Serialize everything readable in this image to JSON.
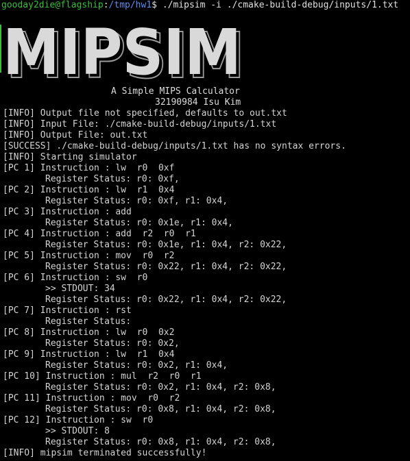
{
  "terminal": {
    "prompt": {
      "user_host": "gooday2die@flagship",
      "separator": ":",
      "path": "/tmp/hw1",
      "symbol": "$",
      "command": "./mipsim -i ./cmake-build-debug/inputs/1.txt"
    },
    "banner": {
      "text": "MIPSIM",
      "fill_color": "#d9d9d9",
      "shadow_color": "#9a9a9a"
    },
    "subtitle": "A Simple MIPS Calculator",
    "author": "32190984 Isu Kim",
    "log_lines": [
      "[INFO] Output file not specified, defaults to out.txt",
      "[INFO] Input File: ./cmake-build-debug/inputs/1.txt",
      "[INFO] Output File: out.txt",
      "[SUCCESS] ./cmake-build-debug/inputs/1.txt has no syntax errors.",
      "[INFO] Starting simulator",
      "[PC 1] Instruction : lw  r0  0xf",
      "Register Status: r0: 0xf,",
      "[PC 2] Instruction : lw  r1  0x4",
      "Register Status: r0: 0xf, r1: 0x4,",
      "[PC 3] Instruction : add",
      "Register Status: r0: 0x1e, r1: 0x4,",
      "[PC 4] Instruction : add  r2  r0  r1",
      "Register Status: r0: 0x1e, r1: 0x4, r2: 0x22,",
      "[PC 5] Instruction : mov  r0  r2",
      "Register Status: r0: 0x22, r1: 0x4, r2: 0x22,",
      "[PC 6] Instruction : sw  r0",
      ">> STDOUT: 34",
      "Register Status: r0: 0x22, r1: 0x4, r2: 0x22,",
      "[PC 7] Instruction : rst",
      "Register Status:",
      "[PC 8] Instruction : lw  r0  0x2",
      "Register Status: r0: 0x2,",
      "[PC 9] Instruction : lw  r1  0x4",
      "Register Status: r0: 0x2, r1: 0x4,",
      "[PC 10] Instruction : mul  r2  r0  r1",
      "Register Status: r0: 0x2, r1: 0x4, r2: 0x8,",
      "[PC 11] Instruction : mov  r0  r2",
      "Register Status: r0: 0x8, r1: 0x4, r2: 0x8,",
      "[PC 12] Instruction : sw  r0",
      ">> STDOUT: 8",
      "Register Status: r0: 0x8, r1: 0x4, r2: 0x8,",
      "[INFO] mipsim terminated successfully!"
    ]
  }
}
